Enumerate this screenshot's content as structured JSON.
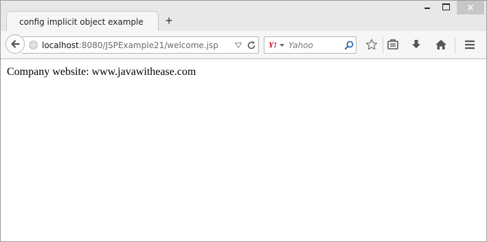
{
  "tab": {
    "title": "config implicit object example",
    "new_tab_symbol": "+"
  },
  "window_controls": {
    "close_symbol": "✕"
  },
  "urlbar": {
    "host": "localhost",
    "rest": ":8080/JSPExample21/welcome.jsp"
  },
  "searchbar": {
    "engine_logo": "Y!",
    "placeholder": "Yahoo"
  },
  "toolbar_icons": [
    "bookmark-star-icon",
    "reading-list-icon",
    "download-icon",
    "home-icon",
    "menu-icon"
  ],
  "page": {
    "text": "Company website: www.javawithease.com"
  },
  "colors": {
    "yahoo_red": "#c4001e",
    "close_button": "#c7c7c7"
  }
}
